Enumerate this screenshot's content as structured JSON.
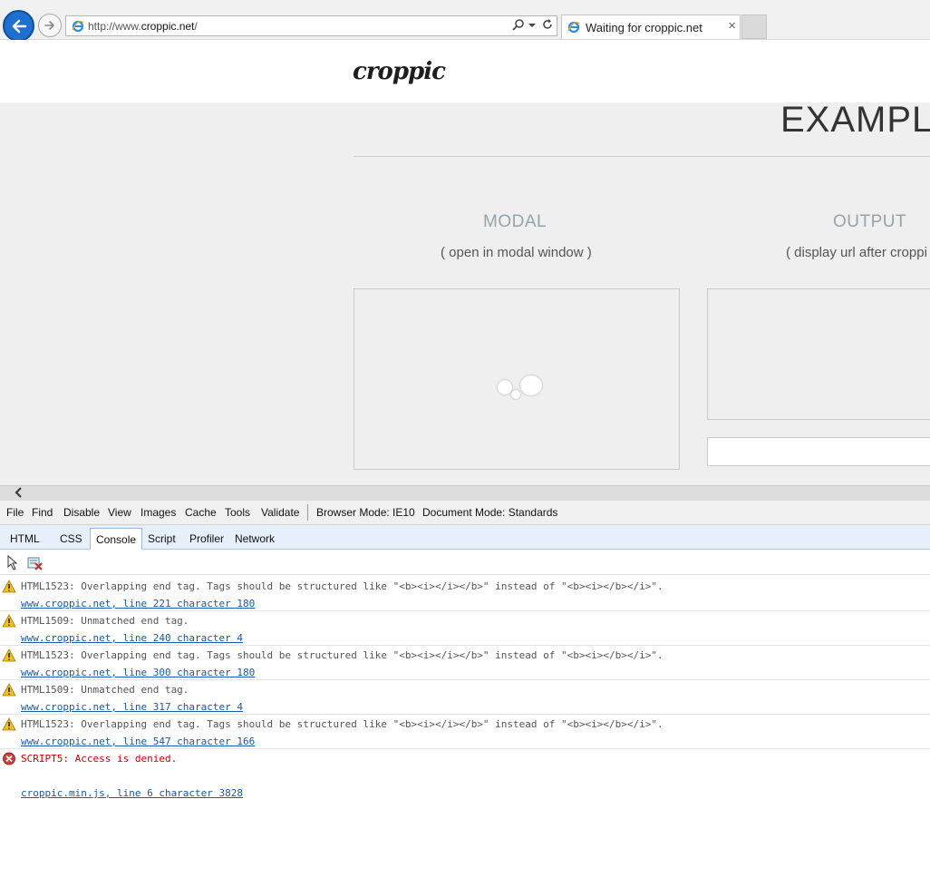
{
  "browser": {
    "address_plain_prefix": "http://www.",
    "address_domain": "croppic.net",
    "address_suffix": "/",
    "tab_title": "Waiting for croppic.net"
  },
  "page": {
    "logo": "croppic",
    "heading": "EXAMPLE",
    "columns": [
      {
        "title": "MODAL",
        "subtitle": "( open in modal window )"
      },
      {
        "title": "OUTPUT",
        "subtitle": "( display url after croppi"
      }
    ]
  },
  "devtools": {
    "menu": [
      "File",
      "Find",
      "Disable",
      "View",
      "Images",
      "Cache",
      "Tools",
      "Validate"
    ],
    "browser_mode": "Browser Mode: IE10",
    "document_mode": "Document Mode: Standards",
    "tabs": [
      "HTML",
      "CSS",
      "Console",
      "Script",
      "Profiler",
      "Network"
    ],
    "active_tab": "Console",
    "messages": [
      {
        "level": "warning",
        "text": "HTML1523: Overlapping end tag. Tags should be structured like \"<b><i></i></b>\" instead of \"<b><i></b></i>\".",
        "link": "www.croppic.net, line 221 character 180"
      },
      {
        "level": "warning",
        "text": "HTML1509: Unmatched end tag.",
        "link": "www.croppic.net, line 240 character 4"
      },
      {
        "level": "warning",
        "text": "HTML1523: Overlapping end tag. Tags should be structured like \"<b><i></i></b>\" instead of \"<b><i></b></i>\".",
        "link": "www.croppic.net, line 300 character 180"
      },
      {
        "level": "warning",
        "text": "HTML1509: Unmatched end tag.",
        "link": "www.croppic.net, line 317 character 4"
      },
      {
        "level": "warning",
        "text": "HTML1523: Overlapping end tag. Tags should be structured like \"<b><i></i></b>\" instead of \"<b><i></b></i>\".",
        "link": "www.croppic.net, line 547 character 166"
      },
      {
        "level": "error",
        "text": "SCRIPT5: Access is denied.",
        "link": "croppic.min.js, line 6 character 3828"
      }
    ]
  },
  "colors": {
    "back_button": "#1e6fd0",
    "error_text": "#cc0000",
    "link": "#1a5aa6",
    "warning_icon": "#f4c01d"
  },
  "icons": [
    "back-arrow-icon",
    "forward-arrow-icon",
    "ie-logo-icon",
    "search-icon",
    "refresh-icon",
    "close-icon",
    "select-element-icon",
    "clear-console-icon",
    "warning-icon",
    "error-icon"
  ]
}
